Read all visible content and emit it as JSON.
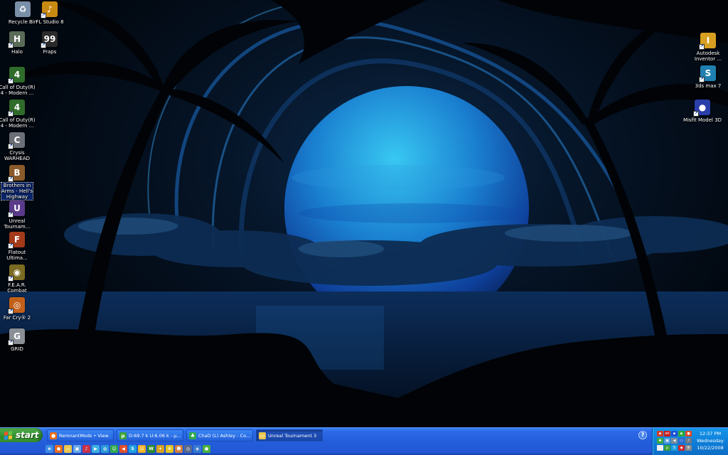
{
  "desktop": {
    "left_icons": [
      {
        "name": "recycle-bin-icon",
        "label": "Recycle Bin",
        "color": "#7a8fa8",
        "glyph": "♻"
      },
      {
        "name": "fl-studio-icon",
        "label": "FL Studio 8",
        "color": "#c98a12",
        "glyph": "♪"
      },
      {
        "name": "halo-icon",
        "label": "Halo",
        "color": "#5a6b58",
        "glyph": "H"
      },
      {
        "name": "fraps-icon",
        "label": "Fraps",
        "color": "#2b2b2b",
        "glyph": "99"
      },
      {
        "name": "cod4-icon-1",
        "label": "Call of Duty(R)\n4 - Modern ...",
        "color": "#2f6b2a",
        "glyph": "4"
      },
      {
        "name": "cod4-icon-2",
        "label": "Call of Duty(R)\n4 - Modern ...",
        "color": "#2f6b2a",
        "glyph": "4"
      },
      {
        "name": "crysis-icon",
        "label": "Crysis\nWARHEAD",
        "color": "#6b6f78",
        "glyph": "C"
      },
      {
        "name": "brothers-in-arms-icon",
        "label": "Brothers in\nArms - Hell's\nHighway",
        "color": "#8a5a2a",
        "glyph": "B"
      },
      {
        "name": "unreal-tournament-icon",
        "label": "Unreal\nTournam...",
        "color": "#5b3a8a",
        "glyph": "U"
      },
      {
        "name": "flatout-icon",
        "label": "Flatout\nUltima...",
        "color": "#a33a1a",
        "glyph": "F"
      },
      {
        "name": "fear-icon",
        "label": "F.E.A.R.\nCombat",
        "color": "#7a6a22",
        "glyph": "◉"
      },
      {
        "name": "far-cry-icon",
        "label": "Far Cry® 2",
        "color": "#c2601a",
        "glyph": "◎"
      },
      {
        "name": "grid-icon",
        "label": "GRID",
        "color": "#8a8f96",
        "glyph": "G"
      }
    ],
    "right_icons": [
      {
        "name": "autodesk-inventor-icon",
        "label": "Autodesk\nInventor ...",
        "color": "#d8a020",
        "glyph": "I"
      },
      {
        "name": "3ds-max-icon",
        "label": "3ds max 7",
        "color": "#1f7fb0",
        "glyph": "S"
      },
      {
        "name": "misfit-model-icon",
        "label": "Misfit Model 3D",
        "color": "#2a3faa",
        "glyph": "●"
      }
    ]
  },
  "taskbar": {
    "start_label": "start",
    "buttons": [
      {
        "name": "task-remnantmods",
        "label": "RemnantMods • View ...",
        "color": "#e86c1a",
        "glyph": "●",
        "active": false
      },
      {
        "name": "task-utorrent",
        "label": "D:69.7 k U:6.06 k - µ...",
        "color": "#3aa13a",
        "glyph": "µ",
        "active": false
      },
      {
        "name": "task-chat",
        "label": "ChaD (L) Ashley - Co...",
        "color": "#2fa84f",
        "glyph": "♣",
        "active": false
      },
      {
        "name": "task-unreal-tournament",
        "label": "Unreal Tournament 3",
        "color": "#e9c64a",
        "glyph": "▭",
        "active": true
      }
    ],
    "quick_launch": [
      {
        "name": "ie-icon",
        "color": "#3b8de6",
        "glyph": "e"
      },
      {
        "name": "firefox-icon",
        "color": "#e86c1a",
        "glyph": "●"
      },
      {
        "name": "folder-icon",
        "color": "#e9c64a",
        "glyph": "▭"
      },
      {
        "name": "desktop-icon",
        "color": "#6aa8e8",
        "glyph": "▣"
      },
      {
        "name": "music-icon",
        "color": "#c8324a",
        "glyph": "♪"
      },
      {
        "name": "media-icon",
        "color": "#3cb0e0",
        "glyph": "▶"
      },
      {
        "name": "globe-icon",
        "color": "#2c9ad8",
        "glyph": "◍"
      },
      {
        "name": "people-icon",
        "color": "#2fa84f",
        "glyph": "☺"
      },
      {
        "name": "speaker-icon",
        "color": "#e0502a",
        "glyph": "◀"
      },
      {
        "name": "skype-icon",
        "color": "#1ea0e0",
        "glyph": "S"
      },
      {
        "name": "smiley-icon",
        "color": "#f0b020",
        "glyph": "☺"
      },
      {
        "name": "winamp-icon",
        "color": "#2c8a2c",
        "glyph": "W"
      },
      {
        "name": "star-icon",
        "color": "#d8a020",
        "glyph": "✦"
      },
      {
        "name": "nuclear-icon",
        "color": "#e2c020",
        "glyph": "☢"
      },
      {
        "name": "face-icon",
        "color": "#d08040",
        "glyph": "☻"
      },
      {
        "name": "disc-icon",
        "color": "#5a6a8a",
        "glyph": "◎"
      },
      {
        "name": "network-icon",
        "color": "#3a7ad0",
        "glyph": "◈"
      },
      {
        "name": "green-icon",
        "color": "#4ab040",
        "glyph": "●"
      }
    ],
    "help_glyph": "?",
    "tray_icons": [
      {
        "name": "tray-flag-icon",
        "color": "#d03a2a",
        "glyph": "▪"
      },
      {
        "name": "tray-ati-icon",
        "color": "#c81818",
        "glyph": "ati"
      },
      {
        "name": "tray-blue-icon",
        "color": "#1c4fd0",
        "glyph": "▪"
      },
      {
        "name": "tray-green-icon",
        "color": "#2ca838",
        "glyph": "▪"
      },
      {
        "name": "tray-red-icon",
        "color": "#e04820",
        "glyph": "●"
      },
      {
        "name": "tray-msn-icon",
        "color": "#3aa840",
        "glyph": "♣"
      },
      {
        "name": "tray-network-icon",
        "color": "#5a9ad8",
        "glyph": "▣"
      },
      {
        "name": "tray-volume-icon",
        "color": "#7a8a9a",
        "glyph": "◀"
      },
      {
        "name": "tray-monitor-icon",
        "color": "#2a6ad0",
        "glyph": "▭"
      },
      {
        "name": "tray-speaker-icon",
        "color": "#6a7a8a",
        "glyph": "♪"
      },
      {
        "name": "tray-chat-icon",
        "color": "#f0f0f0",
        "glyph": "◌"
      },
      {
        "name": "tray-utorrent-icon",
        "color": "#3aa13a",
        "glyph": "µ"
      },
      {
        "name": "tray-skype-icon",
        "color": "#1ea0e0",
        "glyph": "S"
      },
      {
        "name": "tray-shield-icon",
        "color": "#d02828",
        "glyph": "◆"
      },
      {
        "name": "tray-gear-icon",
        "color": "#8a8a8a",
        "glyph": "⚙"
      }
    ],
    "clock": {
      "time": "12:37 PM",
      "day": "Wednesday",
      "date": "10/22/2008"
    }
  }
}
